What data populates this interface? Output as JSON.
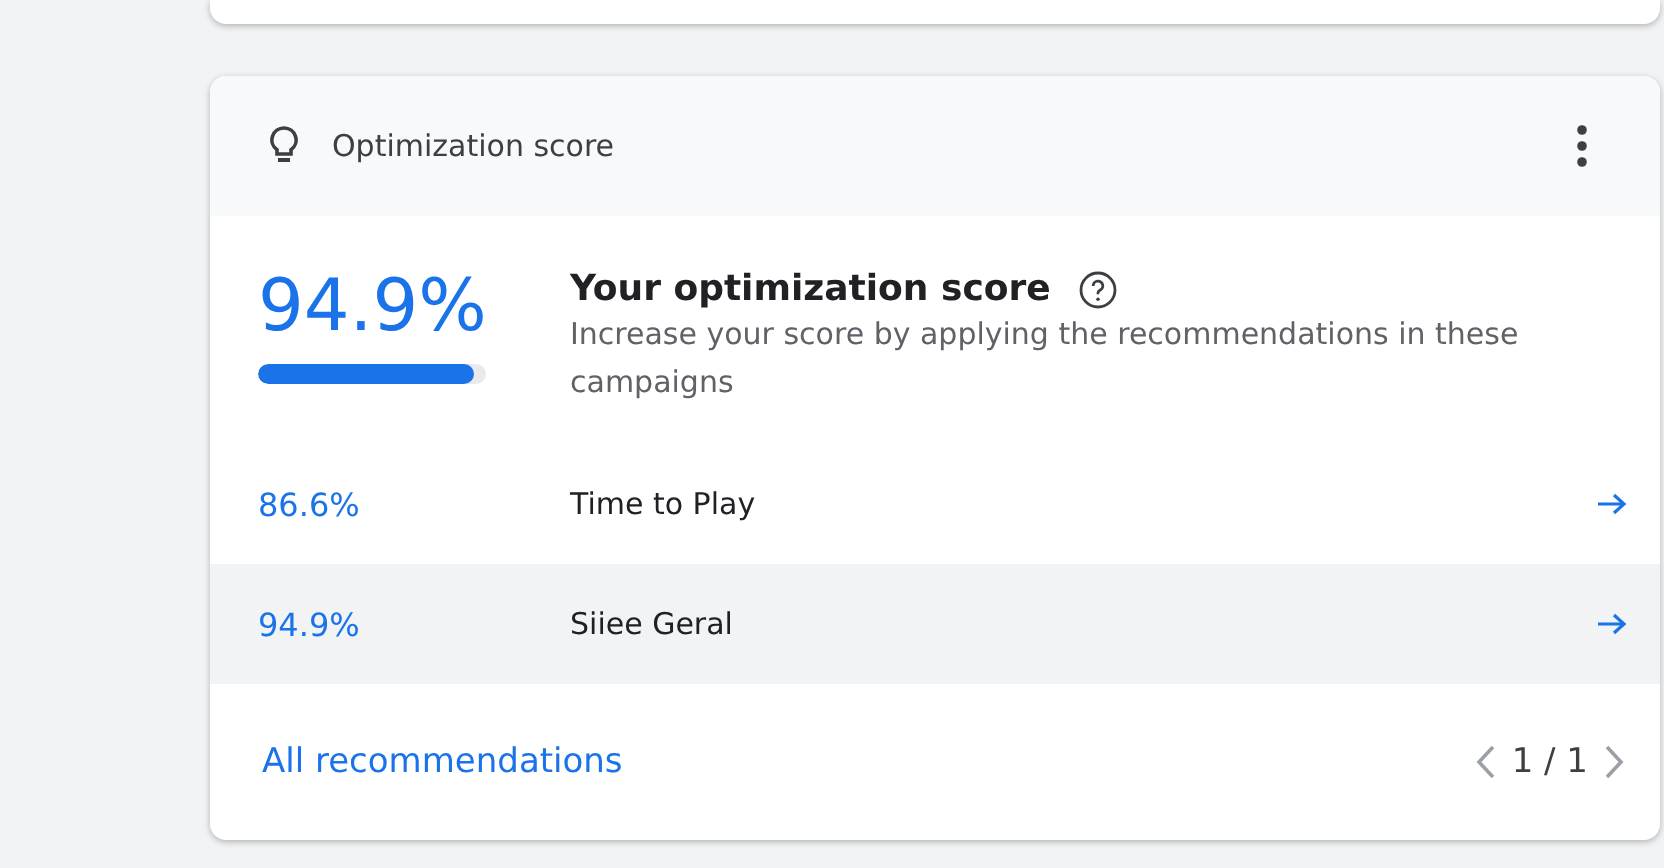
{
  "card": {
    "title": "Optimization score"
  },
  "score": {
    "value": "94.9%",
    "level": 0.949,
    "heading": "Your optimization score",
    "description": "Increase your score by applying the recommendations in these campaigns"
  },
  "campaigns": [
    {
      "score": "86.6%",
      "name": "Time to Play",
      "highlighted": false
    },
    {
      "score": "94.9%",
      "name": "Siiee Geral",
      "highlighted": true
    }
  ],
  "footer": {
    "link": "All recommendations",
    "pager": "1 / 1"
  }
}
